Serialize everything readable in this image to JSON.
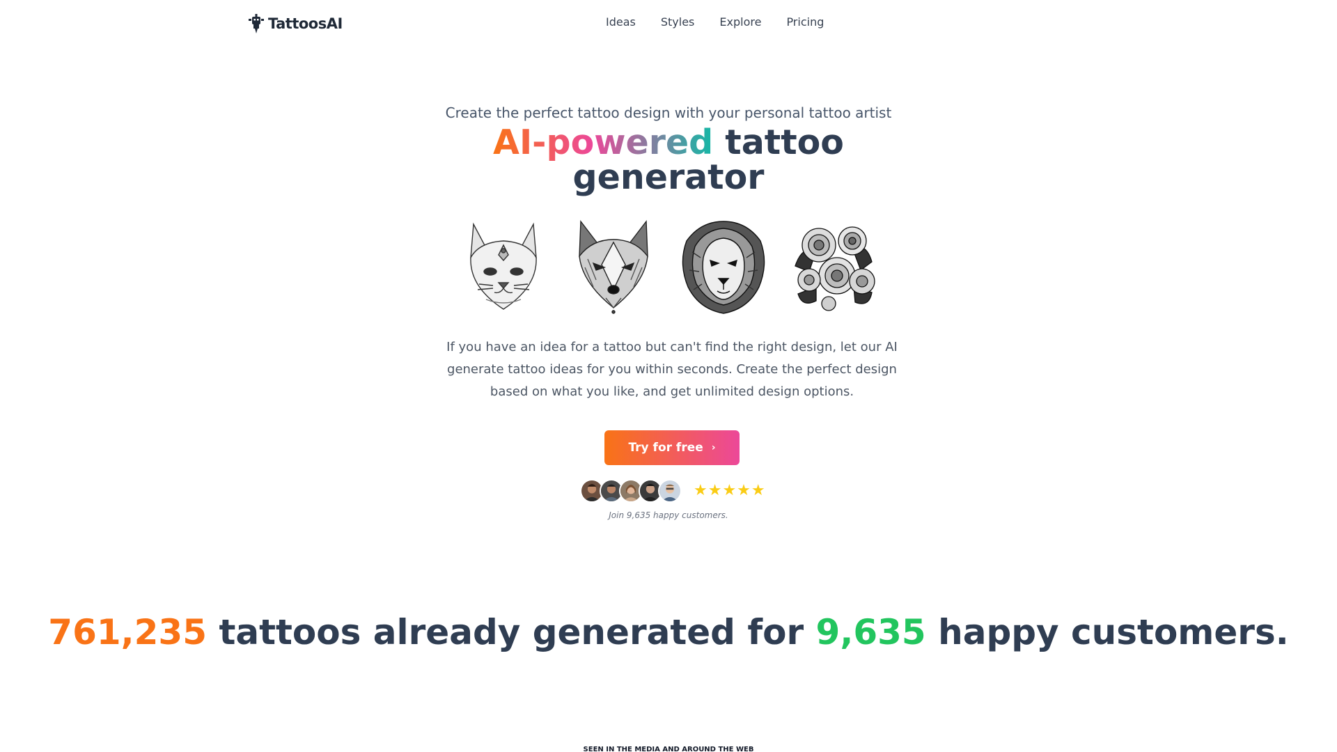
{
  "brand": {
    "name": "TattoosAI",
    "logo_icon": "robot-logo-icon"
  },
  "nav": {
    "items": [
      {
        "label": "Ideas"
      },
      {
        "label": "Styles"
      },
      {
        "label": "Explore"
      },
      {
        "label": "Pricing"
      }
    ]
  },
  "hero": {
    "subtitle": "Create the perfect tattoo design with your personal tattoo artist",
    "title_highlight": "AI-powered",
    "title_rest_1": "tattoo",
    "title_rest_2": "generator",
    "gallery": [
      {
        "icon": "cat-tattoo-icon"
      },
      {
        "icon": "wolf-tattoo-icon"
      },
      {
        "icon": "lion-tattoo-icon"
      },
      {
        "icon": "roses-tattoo-icon"
      }
    ],
    "description": "If you have an idea for a tattoo but can't find the right design, let our AI generate tattoo ideas for you within seconds. Create the perfect design based on what you like, and get unlimited design options.",
    "cta_label": "Try for free",
    "cta_icon": "chevron-right-icon",
    "rating_stars": "★★★★★",
    "rating_value": 5,
    "join_text": "Join 9,635 happy customers."
  },
  "stats": {
    "tattoos_count": "761,235",
    "text_1": "tattoos already generated for",
    "customers_count": "9,635",
    "text_2": "happy customers."
  },
  "media": {
    "heading": "SEEN IN THE MEDIA AND AROUND THE WEB"
  },
  "colors": {
    "accent_orange": "#f97316",
    "accent_pink": "#ec4899",
    "accent_teal": "#14b8a6",
    "accent_green": "#22c55e",
    "star_yellow": "#facc15",
    "heading": "#2f3d52"
  }
}
